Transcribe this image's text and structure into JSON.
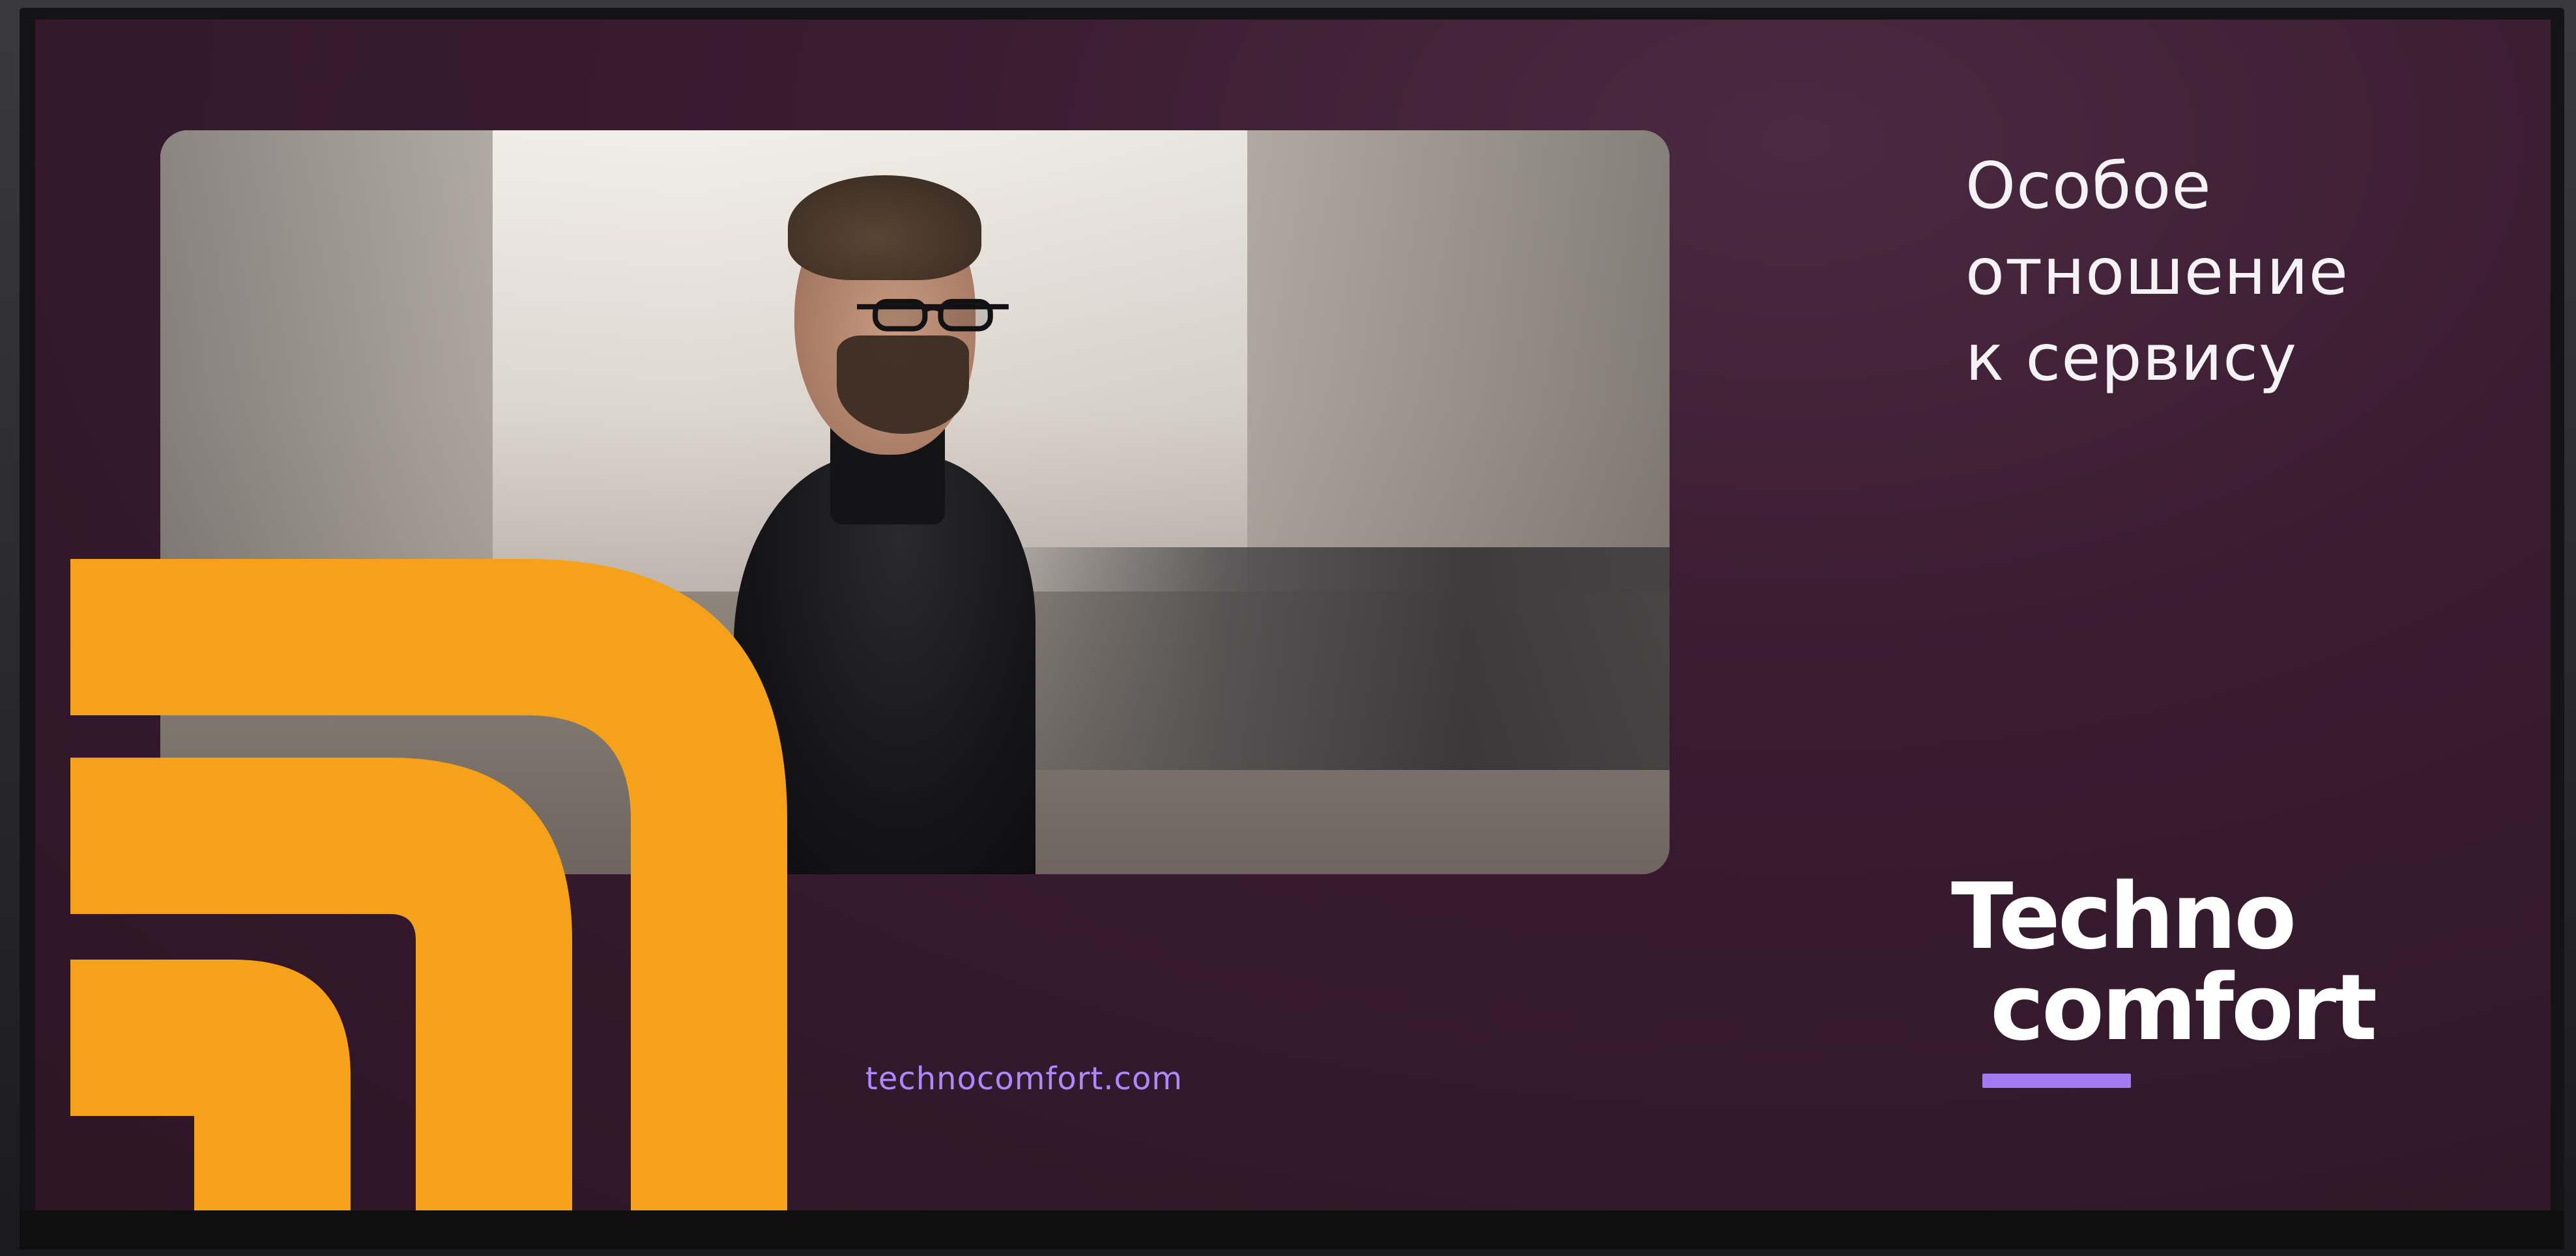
{
  "billboard": {
    "headline": {
      "line1": "Особое",
      "line2": "отношение",
      "line3": "к сервису"
    },
    "website": "technocomfort.com",
    "brand": {
      "line1": "Techno",
      "line2": "comfort"
    },
    "colors": {
      "background": "#3a1c31",
      "accent_orange": "#f5a11a",
      "accent_purple": "#a47af0",
      "text_white": "#f4f2f4"
    }
  }
}
